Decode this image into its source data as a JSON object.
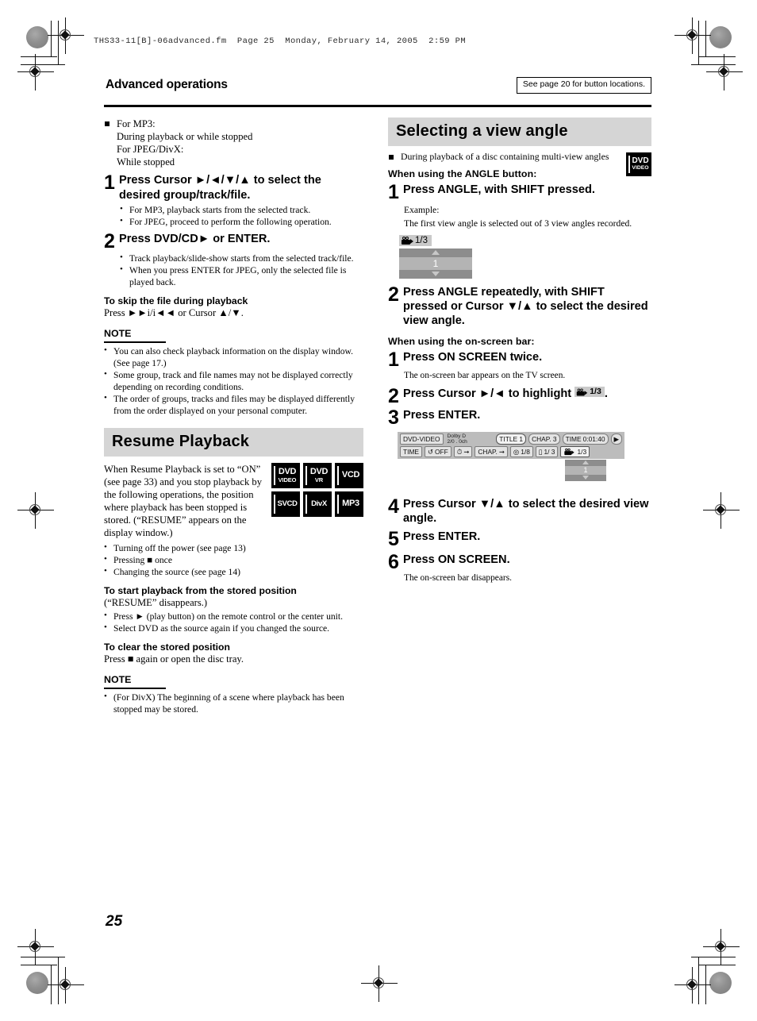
{
  "file_header": "THS33-11[B]-06advanced.fm  Page 25  Monday, February 14, 2005  2:59 PM",
  "page_number": "25",
  "masthead": {
    "title": "Advanced operations",
    "note_box": "See page 20 for button locations."
  },
  "left_column": {
    "intro": {
      "line1": "For MP3:",
      "line2": "During playback or while stopped",
      "line3": "For JPEG/DivX:",
      "line4": "While stopped"
    },
    "steps": [
      {
        "num": "1",
        "text": "Press Cursor ►/◄/▼/▲ to select the desired group/track/file.",
        "bullets": [
          "For MP3, playback starts from the selected track.",
          "For JPEG, proceed to perform the following operation."
        ]
      },
      {
        "num": "2",
        "text": "Press DVD/CD► or ENTER.",
        "bullets": [
          "Track playback/slide-show starts from the selected track/file.",
          "When you press ENTER for JPEG, only the selected file is played back."
        ]
      }
    ],
    "skip": {
      "heading": "To skip the file during playback",
      "body": "Press ►►i/i◄◄ or Cursor ▲/▼."
    },
    "note1": {
      "heading": "NOTE",
      "items": [
        "You can also check playback information on the display window. (See page 17.)",
        "Some group, track and file names may not be displayed correctly depending on recording conditions.",
        "The order of groups, tracks and files may be displayed differently from the order displayed on your personal computer."
      ]
    },
    "resume": {
      "band_title": "Resume Playback",
      "paragraph": "When Resume Playback is set to “ON” (see page 33) and you stop playback by the following operations, the position where playback has been stopped is stored. (“RESUME” appears on the display window.)",
      "bullets": [
        "Turning off the power (see page 13)",
        "Pressing ■ once",
        "Changing the source (see page 14)"
      ],
      "discs": [
        [
          {
            "l1": "DVD",
            "l2": "VIDEO"
          },
          {
            "l1": "DVD",
            "l2": "VR"
          },
          {
            "l1": "VCD",
            "l2": ""
          }
        ],
        [
          {
            "l1": "SVCD",
            "l2": ""
          },
          {
            "l1": "DivX",
            "l2": ""
          },
          {
            "l1": "MP3",
            "l2": ""
          }
        ]
      ],
      "start_heading": "To start playback from the stored position",
      "start_sub": "(“RESUME” disappears.)",
      "start_bullets": [
        "Press ► (play button) on the remote control or the center unit.",
        "Select DVD as the source again if you changed the source."
      ],
      "clear_heading": "To clear the stored position",
      "clear_body": "Press ■ again or open the disc tray.",
      "note_heading": "NOTE",
      "note_items": [
        "(For DivX) The beginning of a scene where playback has been stopped may be stored."
      ]
    }
  },
  "right_column": {
    "band_title": "Selecting a view angle",
    "intro": "During playback of a disc containing multi-view angles",
    "dvd_badge": {
      "l1": "DVD",
      "l2": "VIDEO"
    },
    "angle_button_heading": "When using the ANGLE button:",
    "angle_steps": [
      {
        "num": "1",
        "text": "Press ANGLE, with SHIFT pressed.",
        "sub1": "Example:",
        "sub2": "The first view angle is selected out of 3 view angles recorded."
      },
      {
        "num": "2",
        "text": "Press ANGLE repeatedly, with SHIFT pressed or Cursor ▼/▲ to select the desired view angle."
      }
    ],
    "angle_widget": {
      "tag": "1/3",
      "value": "1"
    },
    "onscreen_heading": "When using the on-screen bar:",
    "onscreen_steps": [
      {
        "num": "1",
        "text": "Press ON SCREEN twice.",
        "sub": "The on-screen bar appears on the TV screen."
      },
      {
        "num": "2",
        "text_before": "Press Cursor ►/◄ to highlight",
        "chip": "1/3",
        "text_after": "."
      },
      {
        "num": "3",
        "text": "Press ENTER."
      },
      {
        "num": "4",
        "text": "Press Cursor ▼/▲ to select the desired view angle."
      },
      {
        "num": "5",
        "text": "Press ENTER."
      },
      {
        "num": "6",
        "text": "Press ON SCREEN.",
        "sub": "The on-screen bar disappears."
      }
    ],
    "onscreen_bar": {
      "disc_type": "DVD-VIDEO",
      "audio_line1": "Dolby D",
      "audio_line2": "2/0 . 0ch",
      "title": "TITLE  1",
      "chapter": "CHAP.  3",
      "time_label": "TIME",
      "time_value": "0:01:40",
      "row2": {
        "time": "TIME",
        "repeat": "OFF",
        "clock_arrow": "",
        "chapter_search": "CHAP.",
        "audio": "1/8",
        "subtitle": "1/ 3",
        "angle": "1/3"
      },
      "dropdown_value": "1"
    }
  }
}
